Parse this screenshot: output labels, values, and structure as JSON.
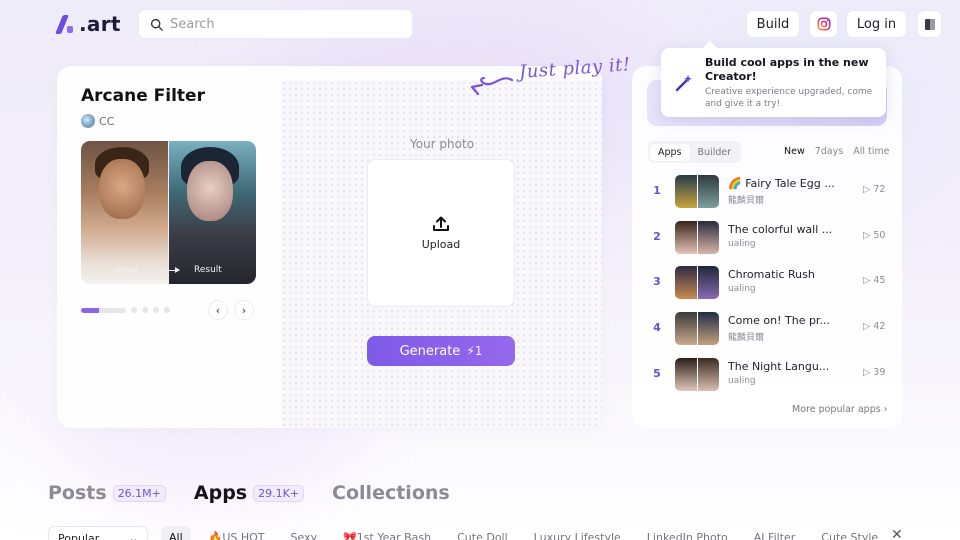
{
  "header": {
    "logo_text": ".art",
    "search_placeholder": "Search",
    "build_label": "Build",
    "login_label": "Log in"
  },
  "app": {
    "title": "Arcane Filter",
    "author": "CC",
    "preview_input_label": "Input",
    "preview_result_label": "Result",
    "photo_label": "Your photo",
    "upload_label": "Upload",
    "generate_label": "Generate",
    "generate_cost": "1",
    "play_text": "Just play it!"
  },
  "tooltip": {
    "title": "Build cool apps in the new Creator!",
    "body": "Creative experience upgraded, come and give it a try!"
  },
  "ranking": {
    "tabs": [
      "Apps",
      "Builder"
    ],
    "ranges": [
      "New",
      "7days",
      "All time"
    ],
    "items": [
      {
        "rank": "1",
        "title": "🌈 Fairy Tale Egg ...",
        "author": "龍麟貝爾",
        "plays": "72"
      },
      {
        "rank": "2",
        "title": "The colorful wall ...",
        "author": "ualing",
        "plays": "50"
      },
      {
        "rank": "3",
        "title": "Chromatic Rush",
        "author": "ualing",
        "plays": "45"
      },
      {
        "rank": "4",
        "title": "Come on! The pr...",
        "author": "龍麟貝爾",
        "plays": "42"
      },
      {
        "rank": "5",
        "title": "The Night Langu...",
        "author": "ualing",
        "plays": "39"
      }
    ],
    "more_label": "More popular apps"
  },
  "bottom": {
    "tabs": [
      {
        "label": "Posts",
        "count": "26.1M+"
      },
      {
        "label": "Apps",
        "count": "29.1K+"
      },
      {
        "label": "Collections",
        "count": ""
      }
    ],
    "sort_value": "Popular",
    "chips": [
      "All",
      "🔥US HOT",
      "Sexy",
      "🎀1st Year Bash",
      "Cute Doll",
      "Luxury Lifestyle",
      "LinkedIn Photo",
      "AI Filter",
      "Cute Style"
    ]
  },
  "colors": {
    "accent": "#7f5ae8",
    "rank_number": "#6b4fd0"
  }
}
